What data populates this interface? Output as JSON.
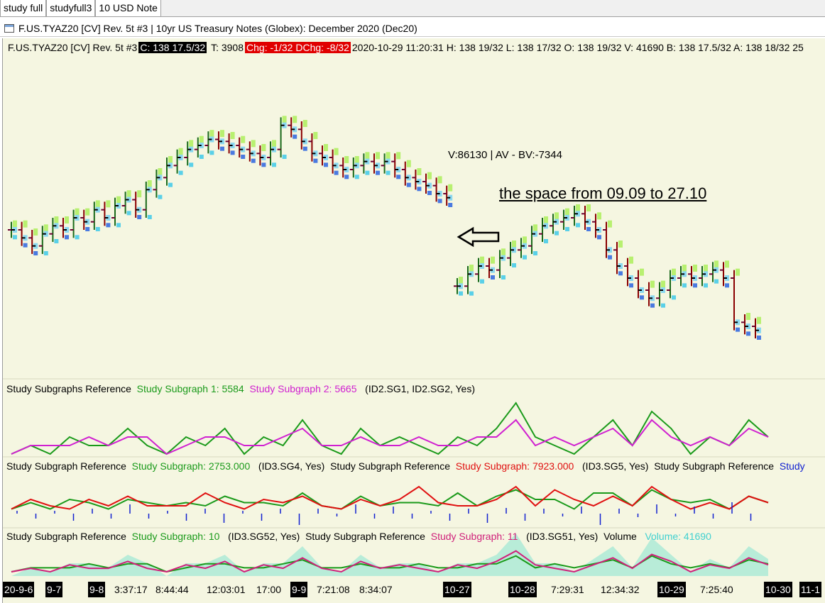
{
  "tabs": [
    "study full",
    "studyfull3",
    "10 USD Note"
  ],
  "window_title": "F.US.TYAZ20 [CV]  Rev. 5t  #3 | 10yr US Treasury Notes (Globex): December 2020 (Dec20)",
  "info": {
    "symbol": "F.US.TYAZ20 [CV]  Rev. 5t  #3",
    "close": "C: 138 17.5/32",
    "trades": "T: 3908",
    "chg": "Chg: -1/32",
    "dchg": "DChg: -8/32",
    "rest": "2020-10-29 11:20:31 H: 138 19/32 L: 138 17/32 O: 138 19/32 V: 41690 B: 138 17.5/32 A: 138 18/32 25"
  },
  "vol_note": "V:86130 | AV - BV:-7344",
  "annotation": "the space from 09.09 to 27.10",
  "colors": {
    "background": "#f5f6e1",
    "green": "#1a9a1a",
    "magenta": "#d020d0",
    "red": "#e01010",
    "volume": "#40d0d0"
  },
  "subgraph1": {
    "title": "Study Subgraphs Reference",
    "sg1": "Study Subgraph 1: 5584",
    "sg2": "Study Subgraph 2: 5665",
    "ref": "(ID2.SG1, ID2.SG2, Yes)"
  },
  "subgraph2": {
    "title_a": "Study Subgraph Reference",
    "sg_a": "Study Subgraph: 2753.000",
    "ref_a": "(ID3.SG4, Yes)",
    "title_b": "Study Subgraph Reference",
    "sg_b": "Study Subgraph: 7923.000",
    "ref_b": "(ID3.SG5, Yes)",
    "title_c": "Study Subgraph Reference",
    "sg_c": "Study"
  },
  "subgraph3": {
    "title_a": "Study Subgraph Reference",
    "sg_a": "Study Subgraph: 10",
    "ref_a": "(ID3.SG52, Yes)",
    "title_b": "Study Subgraph Reference",
    "sg_b": "Study Subgraph: 11",
    "ref_b": "(ID3.SG51, Yes)",
    "vol_title": "Volume",
    "vol_value": "Volume: 41690"
  },
  "time_axis": [
    {
      "label": "20-9-6",
      "dark": true
    },
    {
      "label": "9-7",
      "dark": true
    },
    {
      "label": "9-8",
      "dark": true
    },
    {
      "label": "3:37:17",
      "dark": false
    },
    {
      "label": "8:44:44",
      "dark": false
    },
    {
      "label": "12:03:01",
      "dark": false
    },
    {
      "label": "17:00",
      "dark": false
    },
    {
      "label": "9-9",
      "dark": true
    },
    {
      "label": "7:21:08",
      "dark": false
    },
    {
      "label": "8:34:07",
      "dark": false
    },
    {
      "label": "10-27",
      "dark": true
    },
    {
      "label": "10-28",
      "dark": true
    },
    {
      "label": "7:29:31",
      "dark": false
    },
    {
      "label": "12:34:32",
      "dark": false
    },
    {
      "label": "10-29",
      "dark": true
    },
    {
      "label": "7:25:40",
      "dark": false
    },
    {
      "label": "10-30",
      "dark": true
    },
    {
      "label": "11-1",
      "dark": true
    }
  ],
  "chart_data": {
    "type": "candlestick",
    "segment_a_closes": [
      138.8,
      138.76,
      138.72,
      138.78,
      138.82,
      138.8,
      138.86,
      138.84,
      138.9,
      138.86,
      138.92,
      138.95,
      138.9,
      139.0,
      139.06,
      139.12,
      139.16,
      139.2,
      139.22,
      139.25,
      139.24,
      139.22,
      139.2,
      139.18,
      139.16,
      139.2,
      139.32,
      139.3,
      139.24,
      139.18,
      139.16,
      139.12,
      139.1,
      139.12,
      139.14,
      139.12,
      139.14,
      139.1,
      139.06,
      139.04,
      139.02,
      138.98,
      138.96
    ],
    "segment_b_closes": [
      138.52,
      138.58,
      138.62,
      138.6,
      138.66,
      138.7,
      138.72,
      138.78,
      138.82,
      138.84,
      138.86,
      138.88,
      138.84,
      138.8,
      138.7,
      138.62,
      138.56,
      138.5,
      138.46,
      138.5,
      138.56,
      138.58,
      138.56,
      138.58,
      138.6,
      138.56,
      138.34,
      138.32,
      138.3
    ],
    "subgraph_1_sg1": [
      0,
      1,
      0,
      2,
      1,
      1,
      3,
      1,
      0,
      2,
      1,
      3,
      0,
      2,
      1,
      4,
      1,
      0,
      3,
      1,
      2,
      1,
      0,
      2,
      1,
      3,
      6,
      2,
      1,
      0,
      2,
      4,
      1,
      5,
      3,
      0,
      2,
      1,
      4,
      2
    ],
    "subgraph_1_sg2": [
      0,
      1,
      1,
      1,
      2,
      1,
      2,
      2,
      0,
      1,
      2,
      2,
      1,
      1,
      2,
      3,
      1,
      1,
      2,
      1,
      1,
      2,
      1,
      1,
      2,
      2,
      4,
      1,
      2,
      1,
      2,
      3,
      1,
      4,
      2,
      1,
      2,
      1,
      3,
      2
    ],
    "volume_note": "Volume: 41690"
  }
}
